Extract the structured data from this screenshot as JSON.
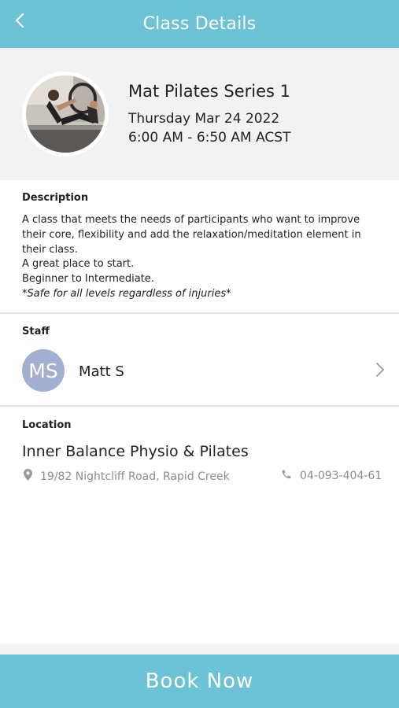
{
  "header": {
    "title": "Class Details",
    "back_icon": "chevron-left-icon",
    "background_color": "#6cc3d5"
  },
  "class_info": {
    "name": "Mat Pilates Series 1",
    "date": "Thursday Mar 24 2022",
    "time": "6:00 AM - 6:50 AM ACST"
  },
  "description": {
    "label": "Description",
    "lines": [
      "A class that meets the needs of participants who want to improve",
      "their core, flexibility and add the relaxation/meditation element in",
      "their class.",
      "A great place to start.",
      "Beginner to Intermediate.",
      "*Safe for all levels regardless of injuries*"
    ]
  },
  "staff": {
    "label": "Staff",
    "initials": "MS",
    "name": "Matt S",
    "avatar_color": "#a3afd0"
  },
  "location": {
    "label": "Location",
    "name": "Inner Balance Physio & Pilates",
    "address": "19/82 Nightcliff Road, Rapid Creek",
    "phone": "04-093-404-61",
    "address_icon": "map-pin-icon",
    "phone_icon": "phone-icon"
  },
  "footer": {
    "book_label": "Book Now"
  }
}
